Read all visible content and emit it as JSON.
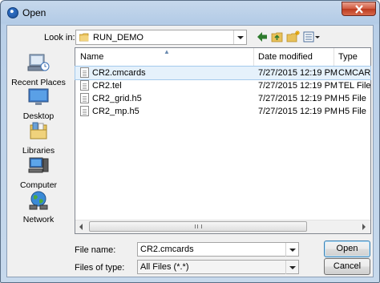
{
  "window": {
    "title": "Open"
  },
  "toolbar": {
    "look_in_label": "Look in:",
    "look_in_value": "RUN_DEMO"
  },
  "places": [
    {
      "label": "Recent Places",
      "icon": "recent-places-icon"
    },
    {
      "label": "Desktop",
      "icon": "desktop-icon"
    },
    {
      "label": "Libraries",
      "icon": "libraries-icon"
    },
    {
      "label": "Computer",
      "icon": "computer-icon"
    },
    {
      "label": "Network",
      "icon": "network-icon"
    }
  ],
  "filelist": {
    "columns": [
      "Name",
      "Date modified",
      "Type"
    ],
    "rows": [
      {
        "name": "CR2.cmcards",
        "date": "7/27/2015 12:19 PM",
        "type": "CMCARDS",
        "selected": true
      },
      {
        "name": "CR2.tel",
        "date": "7/27/2015 12:19 PM",
        "type": "TEL File"
      },
      {
        "name": "CR2_grid.h5",
        "date": "7/27/2015 12:19 PM",
        "type": "H5 File"
      },
      {
        "name": "CR2_mp.h5",
        "date": "7/27/2015 12:19 PM",
        "type": "H5 File"
      }
    ]
  },
  "form": {
    "file_name_label": "File name:",
    "file_name_value": "CR2.cmcards",
    "files_of_type_label": "Files of type:",
    "files_of_type_value": "All Files (*.*)"
  },
  "buttons": {
    "open": "Open",
    "cancel": "Cancel"
  }
}
